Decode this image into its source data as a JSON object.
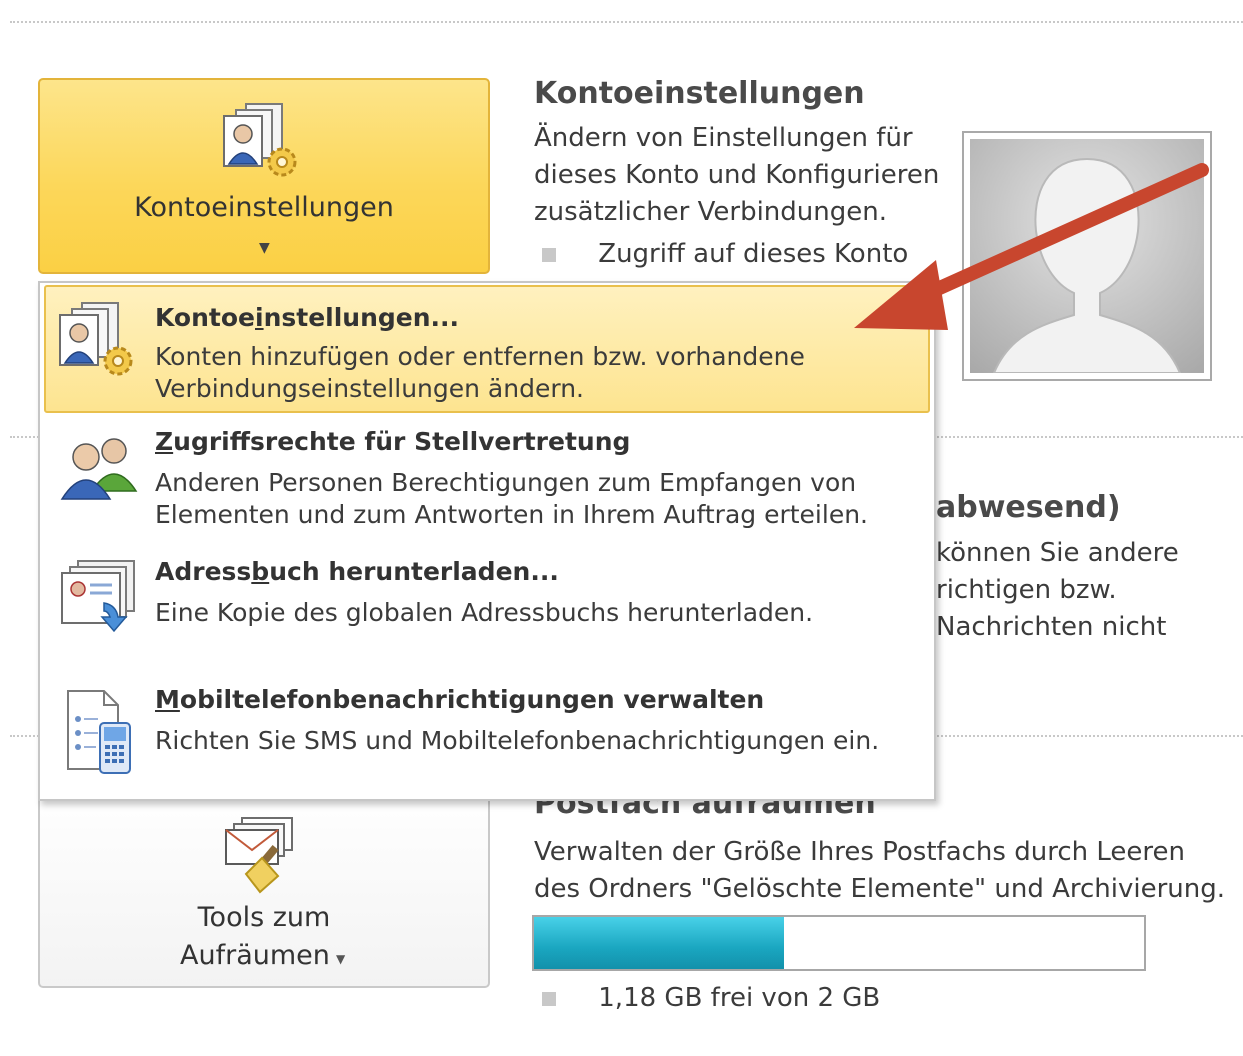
{
  "account_settings": {
    "button_label": "Kontoeinstellungen",
    "title": "Kontoeinstellungen",
    "description": "Ändern von Einstellungen für dieses Konto und Konfigurieren zusätzlicher Verbindungen.",
    "bullet": "Zugriff auf dieses Konto"
  },
  "menu": {
    "items": [
      {
        "title_before": "Kontoe",
        "title_accel": "i",
        "title_after": "nstellungen...",
        "description": "Konten hinzufügen oder entfernen bzw. vorhandene Verbindungseinstellungen ändern.",
        "icon": "account-settings-icon"
      },
      {
        "title_before": "",
        "title_accel": "Z",
        "title_after": "ugriffsrechte für Stellvertretung",
        "description": "Anderen Personen Berechtigungen zum Empfangen von Elementen und zum Antworten in Ihrem Auftrag erteilen.",
        "icon": "delegate-users-icon"
      },
      {
        "title_before": "Adress",
        "title_accel": "b",
        "title_after": "uch herunterladen...",
        "description": "Eine Kopie des globalen Adressbuchs herunterladen.",
        "icon": "address-book-download-icon"
      },
      {
        "title_before": "",
        "title_accel": "M",
        "title_after": "obiltelefonbenachrichtigungen verwalten",
        "description": "Richten Sie SMS und Mobiltelefonbenachrichtigungen ein.",
        "icon": "mobile-notifications-icon"
      }
    ]
  },
  "automatic_replies": {
    "title_fragment": "abwesend)",
    "desc_fragments": [
      "können Sie andere",
      "richtigen bzw.",
      "Nachrichten nicht"
    ]
  },
  "mailbox_cleanup": {
    "title": "Postfach aufräumen",
    "description": "Verwalten der Größe Ihres Postfachs durch Leeren des Ordners \"Gelöschte Elemente\" und Archivierung.",
    "button_line1": "Tools zum",
    "button_line2": "Aufräumen",
    "usage_text": "1,18 GB frei von 2 GB",
    "usage_fraction": 0.41
  },
  "colors": {
    "highlight": "#fcd75a",
    "progress": "#1aa6c0",
    "arrow": "#c8462e"
  }
}
